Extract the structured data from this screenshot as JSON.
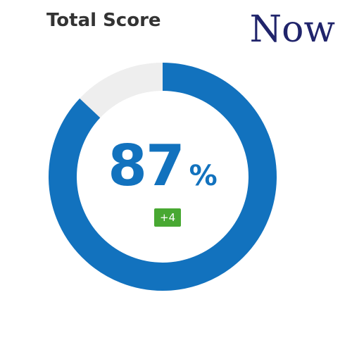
{
  "header": {
    "title": "Total Score",
    "now_label": "Now"
  },
  "score": {
    "value": "87",
    "unit": "%",
    "change": "+4",
    "fraction": 0.87
  },
  "colors": {
    "ring_fill": "#1272be",
    "ring_track": "#eeeeee",
    "badge": "#48a832",
    "title": "#333333",
    "now": "#20246b"
  }
}
